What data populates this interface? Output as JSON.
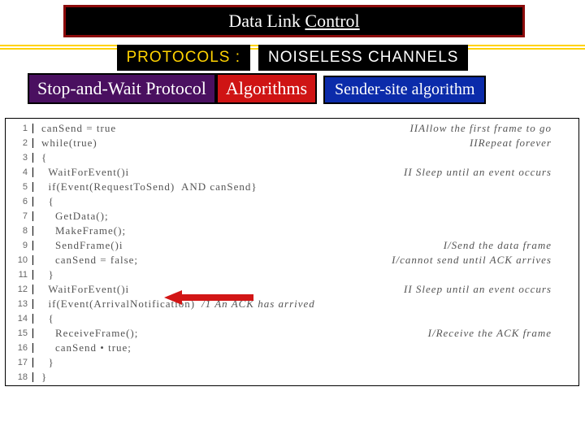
{
  "title": {
    "text": "Data Link Control",
    "underline_start": 10
  },
  "badges": {
    "protocols": "PROTOCOLS :",
    "noiseless": "NOISELESS CHANNELS",
    "stopwait": "Stop-and-Wait Protocol",
    "algorithms": "Algorithms",
    "sender": "Sender-site algorithm"
  },
  "code": [
    {
      "n": "1",
      "c": "canSend = true",
      "m": "IIAllow the first frame to go"
    },
    {
      "n": "2",
      "c": "while(true)",
      "m": "IIRepeat  forever"
    },
    {
      "n": "3",
      "c": "{",
      "m": ""
    },
    {
      "n": "4",
      "c": "  WaitForEvent()i",
      "m": "II  Sleep until an event occurs"
    },
    {
      "n": "5",
      "c": "  if(Event(RequestToSend)  AND canSend}",
      "m": ""
    },
    {
      "n": "6",
      "c": "  {",
      "m": ""
    },
    {
      "n": "7",
      "c": "    GetData();",
      "m": ""
    },
    {
      "n": "8",
      "c": "    MakeFrame();",
      "m": ""
    },
    {
      "n": "9",
      "c": "    SendFrame()i",
      "m": "I/Send the data frame"
    },
    {
      "n": "10",
      "c": "    canSend = false;",
      "m": "I/cannot send until ACK arrives"
    },
    {
      "n": "11",
      "c": "  }",
      "m": ""
    },
    {
      "n": "12",
      "c": "  WaitForEvent()i",
      "m": "II  Sleep until an event occurs"
    },
    {
      "n": "13",
      "c": "  if(Event(ArrivalNotification)",
      "m_near": "/1 An ACK has arrived"
    },
    {
      "n": "14",
      "c": "  {",
      "m": ""
    },
    {
      "n": "15",
      "c": "    ReceiveFrame();",
      "m": "I/Receive the ACK frame"
    },
    {
      "n": "16",
      "c": "    canSend • true;",
      "m": ""
    },
    {
      "n": "17",
      "c": "  }",
      "m": ""
    },
    {
      "n": "18",
      "c": "}",
      "m": ""
    }
  ]
}
